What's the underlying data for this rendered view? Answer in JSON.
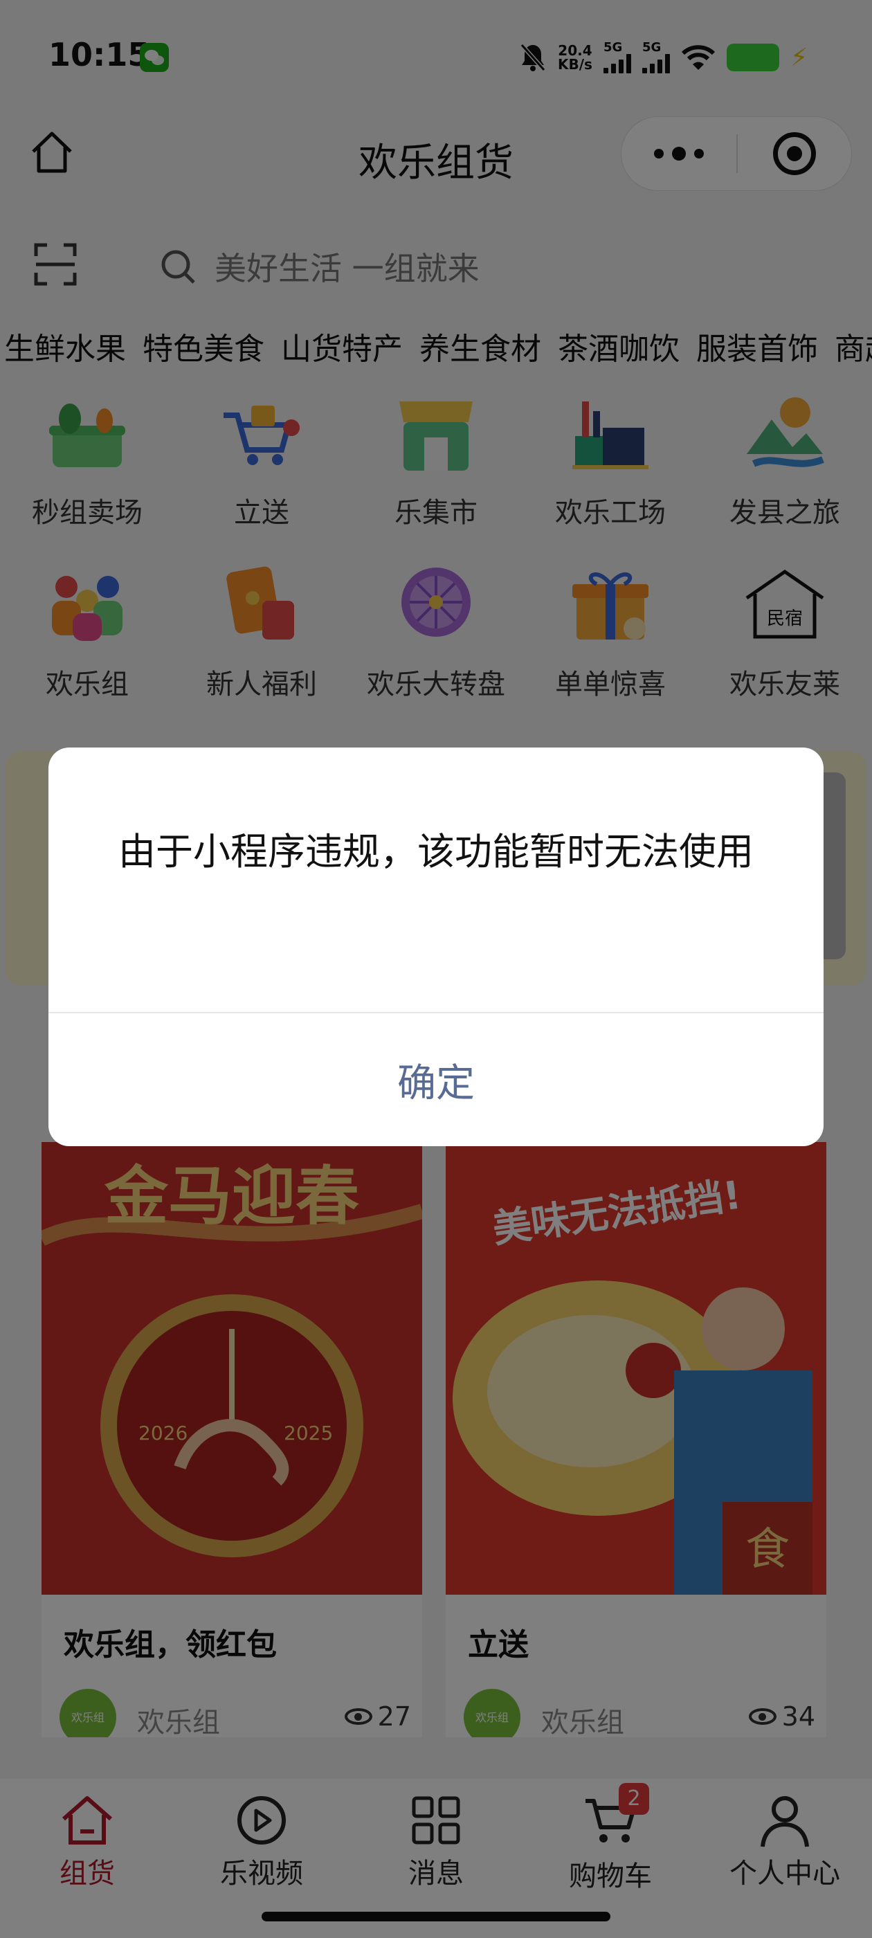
{
  "status_bar": {
    "time": "10:15",
    "net_speed_value": "20.4",
    "net_speed_unit": "KB/s",
    "sim1": "5G",
    "sim2": "5G"
  },
  "header": {
    "title": "欢乐组货"
  },
  "search": {
    "placeholder": "美好生活 一组就来"
  },
  "categories": [
    "生鲜水果",
    "特色美食",
    "山货特产",
    "养生食材",
    "茶酒咖饮",
    "服装首饰",
    "商超超"
  ],
  "grid": [
    {
      "label": "秒组卖场",
      "icon": "basket-icon"
    },
    {
      "label": "立送",
      "icon": "delivery-cart-icon"
    },
    {
      "label": "乐集市",
      "icon": "market-stall-icon"
    },
    {
      "label": "欢乐工场",
      "icon": "factory-icon"
    },
    {
      "label": "发县之旅",
      "icon": "landscape-icon"
    },
    {
      "label": "欢乐组",
      "icon": "group-people-icon"
    },
    {
      "label": "新人福利",
      "icon": "red-envelope-icon"
    },
    {
      "label": "欢乐大转盘",
      "icon": "prize-wheel-icon"
    },
    {
      "label": "单单惊喜",
      "icon": "gift-box-icon"
    },
    {
      "label": "欢乐友莱",
      "icon": "homestay-icon",
      "icon_text": "民宿"
    }
  ],
  "cards": [
    {
      "title": "欢乐组，领红包",
      "shop": "欢乐组",
      "avatar_text": "欢乐组",
      "views": "27",
      "image_text": "金马迎春",
      "image_years": [
        "2026",
        "2025"
      ]
    },
    {
      "title": "立送",
      "shop": "欢乐组",
      "avatar_text": "欢乐组",
      "views": "34",
      "image_text": "美味无法抵挡!",
      "image_badge": "食"
    }
  ],
  "tabbar": {
    "tabs": [
      {
        "label": "组货",
        "icon": "home-icon",
        "active": true
      },
      {
        "label": "乐视频",
        "icon": "video-icon"
      },
      {
        "label": "消息",
        "icon": "grid-icon"
      },
      {
        "label": "购物车",
        "icon": "cart-icon",
        "badge": "2"
      },
      {
        "label": "个人中心",
        "icon": "user-icon"
      }
    ]
  },
  "modal": {
    "message": "由于小程序违规，该功能暂时无法使用",
    "confirm_label": "确定"
  },
  "colors": {
    "accent": "#b0182c",
    "modal_button": "#576b95",
    "badge": "#e23b3b"
  }
}
